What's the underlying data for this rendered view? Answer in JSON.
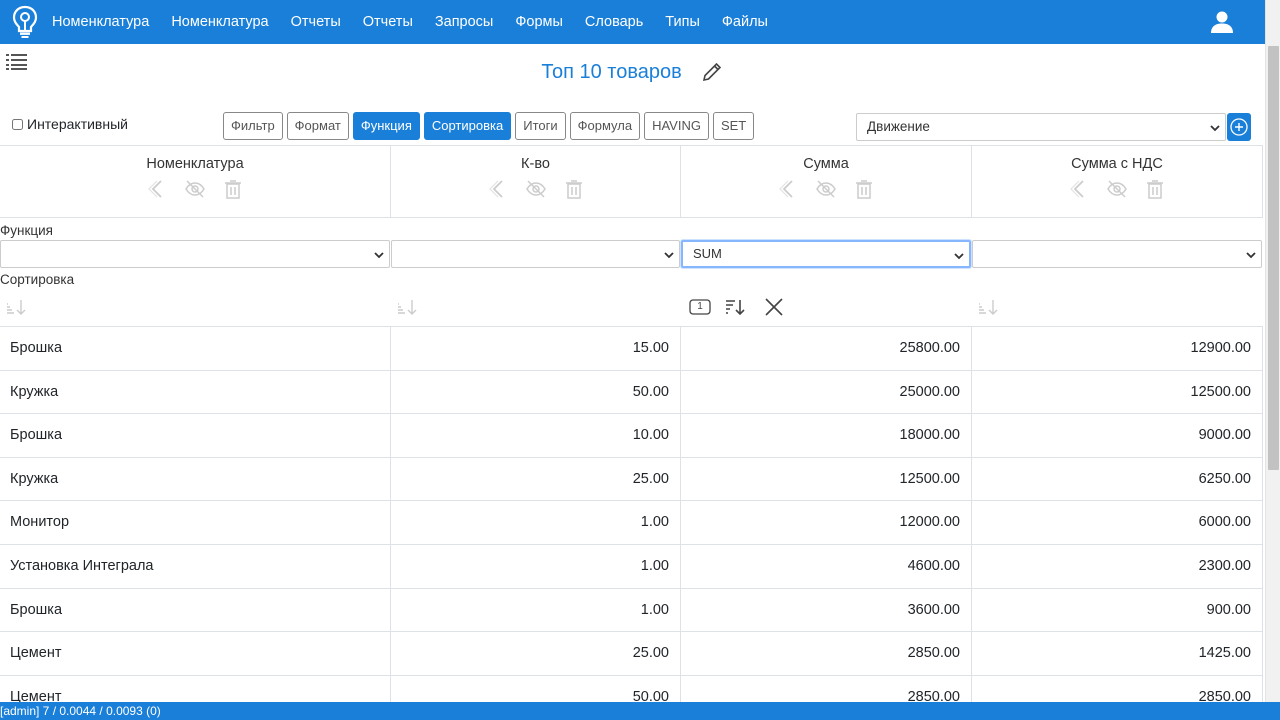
{
  "nav": {
    "items": [
      "Номенклатура",
      "Номенклатура",
      "Отчеты",
      "Отчеты",
      "Запросы",
      "Формы",
      "Словарь",
      "Типы",
      "Файлы"
    ]
  },
  "report": {
    "title": "Топ 10 товаров",
    "interactive_label": "Интерактивный"
  },
  "toolbar": {
    "buttons": [
      {
        "label": "Фильтр",
        "active": false
      },
      {
        "label": "Формат",
        "active": false
      },
      {
        "label": "Функция",
        "active": true
      },
      {
        "label": "Сортировка",
        "active": true
      },
      {
        "label": "Итоги",
        "active": false
      },
      {
        "label": "Формула",
        "active": false
      },
      {
        "label": "HAVING",
        "active": false
      },
      {
        "label": "SET",
        "active": false
      }
    ],
    "table_select_value": "Движение"
  },
  "columns": [
    {
      "label": "Номенклатура",
      "function": "",
      "sorted": false
    },
    {
      "label": "К-во",
      "function": "",
      "sorted": false
    },
    {
      "label": "Сумма",
      "function": "SUM",
      "sorted": true,
      "sort_order": "1"
    },
    {
      "label": "Сумма с НДС",
      "function": "",
      "sorted": false
    }
  ],
  "sections": {
    "function_label": "Функция",
    "sort_label": "Сортировка"
  },
  "rows": [
    [
      "Брошка",
      "15.00",
      "25800.00",
      "12900.00"
    ],
    [
      "Кружка",
      "50.00",
      "25000.00",
      "12500.00"
    ],
    [
      "Брошка",
      "10.00",
      "18000.00",
      "9000.00"
    ],
    [
      "Кружка",
      "25.00",
      "12500.00",
      "6250.00"
    ],
    [
      "Монитор",
      "1.00",
      "12000.00",
      "6000.00"
    ],
    [
      "Установка Интеграла",
      "1.00",
      "4600.00",
      "2300.00"
    ],
    [
      "Брошка",
      "1.00",
      "3600.00",
      "900.00"
    ],
    [
      "Цемент",
      "25.00",
      "2850.00",
      "1425.00"
    ],
    [
      "Цемент",
      "50.00",
      "2850.00",
      "2850.00"
    ]
  ],
  "status": {
    "text": "[admin] 7 / 0.0044 / 0.0093 (0)"
  },
  "colors": {
    "primary": "#1a7fd8",
    "border": "#dee2e6"
  }
}
